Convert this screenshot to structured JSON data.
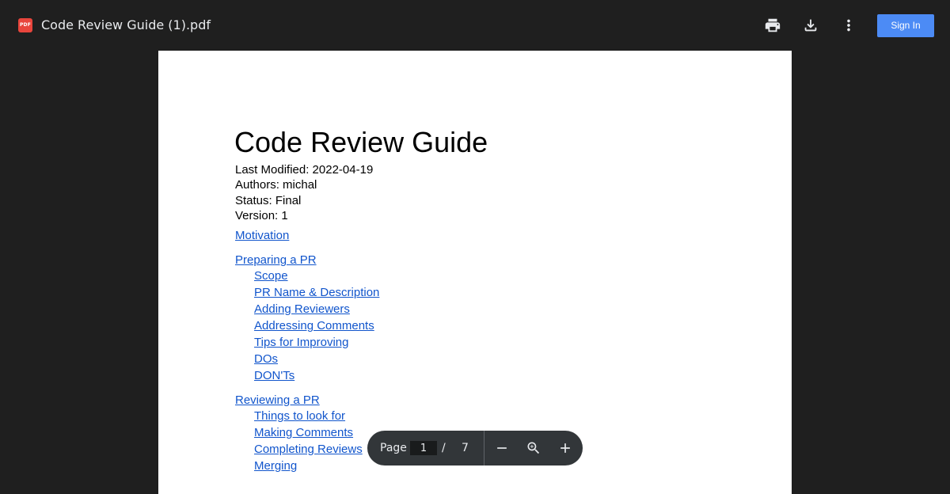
{
  "toolbar": {
    "file_icon_text": "PDF",
    "file_name": "Code Review Guide (1).pdf",
    "print_icon": "print-icon",
    "download_icon": "download-icon",
    "more_icon": "more-vert-icon",
    "sign_in_label": "Sign In"
  },
  "document": {
    "title": "Code Review Guide",
    "meta": [
      "Last Modified: 2022-04-19",
      "Authors: michal",
      "Status: Final",
      "Version: 1"
    ],
    "toc": [
      {
        "label": "Motivation",
        "level": 1
      },
      {
        "label": "Preparing a PR",
        "level": 1
      },
      {
        "label": "Scope",
        "level": 2
      },
      {
        "label": "PR Name & Description",
        "level": 2
      },
      {
        "label": "Adding Reviewers",
        "level": 2
      },
      {
        "label": "Addressing Comments",
        "level": 2
      },
      {
        "label": "Tips for Improving",
        "level": 2
      },
      {
        "label": "DOs",
        "level": 2
      },
      {
        "label": "DON'Ts",
        "level": 2
      },
      {
        "label": "Reviewing a PR",
        "level": 1
      },
      {
        "label": "Things to look for",
        "level": 2
      },
      {
        "label": "Making Comments",
        "level": 2
      },
      {
        "label": "Completing Reviews",
        "level": 2
      },
      {
        "label": "Merging",
        "level": 2
      }
    ]
  },
  "pager": {
    "page_label": "Page",
    "current_page": "1",
    "separator": "/",
    "total_pages": "7",
    "zoom_out_icon": "minus-icon",
    "zoom_fit_icon": "zoom-icon",
    "zoom_in_icon": "plus-icon"
  },
  "colors": {
    "background": "#1f1f1f",
    "accent": "#4c8bf5",
    "link": "#1155cc",
    "pdf_badge": "#e8453c"
  }
}
